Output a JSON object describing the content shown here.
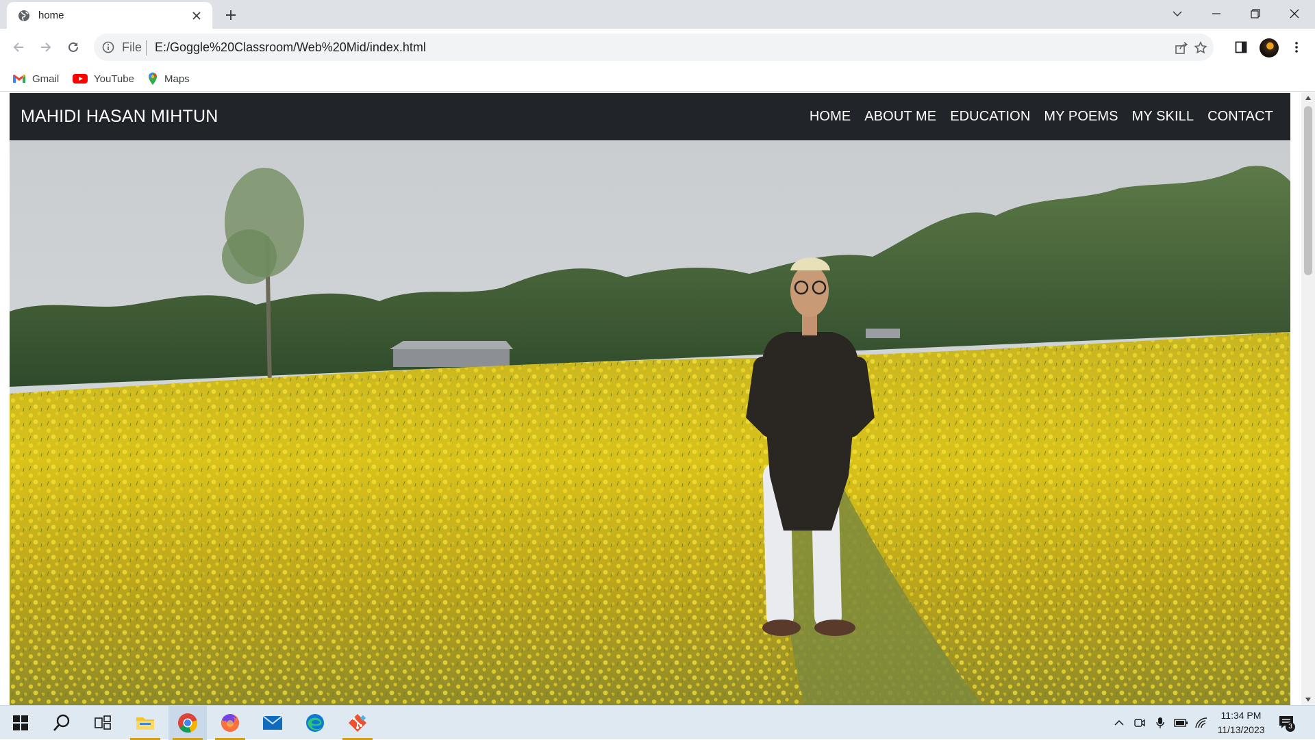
{
  "browser": {
    "tab": {
      "title": "home"
    },
    "address": {
      "scheme": "File",
      "url": "E:/Goggle%20Classroom/Web%20Mid/index.html"
    },
    "bookmarks": [
      {
        "label": "Gmail",
        "icon": "gmail-icon"
      },
      {
        "label": "YouTube",
        "icon": "youtube-icon"
      },
      {
        "label": "Maps",
        "icon": "maps-icon"
      }
    ]
  },
  "site": {
    "brand": "MAHIDI HASAN MIHTUN",
    "menu": [
      "HOME",
      "ABOUT ME",
      "EDUCATION",
      "MY POEMS",
      "MY SKILL",
      "CONTACT"
    ],
    "hero_image": "man-in-mustard-field-photo"
  },
  "taskbar": {
    "apps": [
      "start-icon",
      "search-icon",
      "task-view-icon",
      "file-explorer-icon",
      "chrome-icon",
      "firefox-icon",
      "mail-icon",
      "edge-icon",
      "git-icon"
    ],
    "time": "11:34 PM",
    "date": "11/13/2023",
    "notifications": "3"
  },
  "colors": {
    "navbar_bg": "#212529",
    "tabstrip_bg": "#dee1e6",
    "taskbar_bg": "#dfe9f2"
  }
}
